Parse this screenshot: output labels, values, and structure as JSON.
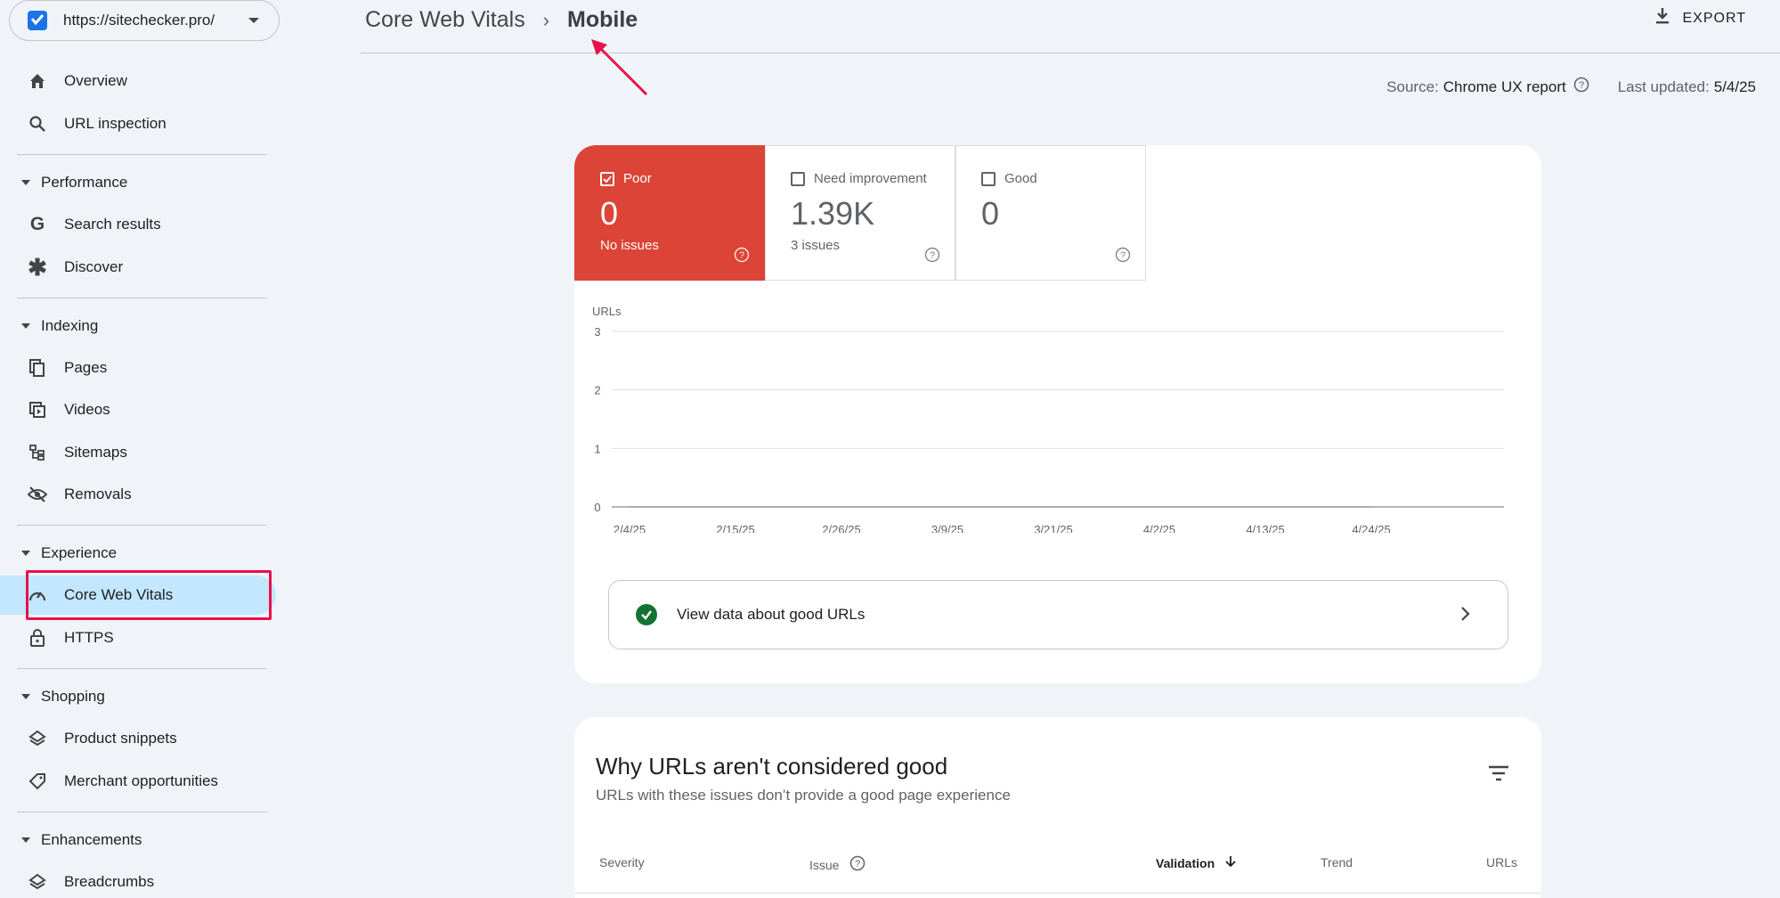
{
  "property": {
    "url": "https://sitechecker.pro/"
  },
  "nav": {
    "overview": "Overview",
    "url_inspection": "URL inspection",
    "performance": "Performance",
    "search_results": "Search results",
    "discover": "Discover",
    "indexing": "Indexing",
    "pages": "Pages",
    "videos": "Videos",
    "sitemaps": "Sitemaps",
    "removals": "Removals",
    "experience": "Experience",
    "core_web_vitals": "Core Web Vitals",
    "https": "HTTPS",
    "shopping": "Shopping",
    "product_snippets": "Product snippets",
    "merchant_opportunities": "Merchant opportunities",
    "enhancements": "Enhancements",
    "breadcrumbs": "Breadcrumbs"
  },
  "header": {
    "crumb_parent": "Core Web Vitals",
    "crumb_current": "Mobile",
    "export_label": "EXPORT"
  },
  "meta": {
    "source_label": "Source:",
    "source_value": "Chrome UX report",
    "updated_label": "Last updated:",
    "updated_value": "5/4/25"
  },
  "tiles": {
    "poor": {
      "label": "Poor",
      "value": "0",
      "sub": "No issues"
    },
    "need": {
      "label": "Need improvement",
      "value": "1.39K",
      "sub": "3 issues"
    },
    "good": {
      "label": "Good",
      "value": "0",
      "sub": ""
    }
  },
  "chart_data": {
    "type": "line",
    "ylabel": "URLs",
    "ylim": [
      0,
      3
    ],
    "yticks": [
      0,
      1,
      2,
      3
    ],
    "x": [
      "2/4/25",
      "2/15/25",
      "2/26/25",
      "3/9/25",
      "3/21/25",
      "4/2/25",
      "4/13/25",
      "4/24/25"
    ],
    "series": [
      {
        "values": [
          0,
          0,
          0,
          0,
          0,
          0,
          0,
          0
        ]
      }
    ],
    "grid": true
  },
  "good_urls": {
    "label": "View data about good URLs"
  },
  "issues_card": {
    "title": "Why URLs aren't considered good",
    "subtitle": "URLs with these issues don’t provide a good page experience",
    "columns": {
      "severity": "Severity",
      "issue": "Issue",
      "validation": "Validation",
      "trend": "Trend",
      "urls": "URLs"
    }
  },
  "colors": {
    "poor": "#dc4437",
    "active_nav": "#c2e7ff",
    "highlight": "#e8114a",
    "good": "#137333"
  }
}
